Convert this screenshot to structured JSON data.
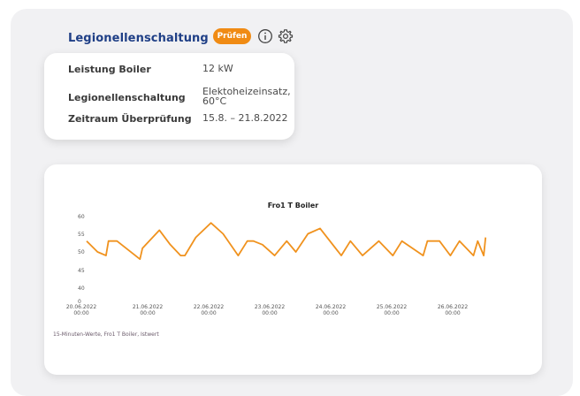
{
  "header": {
    "title": "Legionellenschaltung",
    "badge_label": "Prüfen",
    "info_icon": "info-icon",
    "settings_icon": "gear-icon"
  },
  "details": {
    "rows": [
      {
        "key": "Leistung Boiler",
        "value": "12 kW"
      },
      {
        "key": "Legionellenschaltung",
        "value": "Elektoheizeinsatz, 60°C"
      },
      {
        "key": "Zeitraum Überprüfung",
        "value": "15.8. – 21.8.2022"
      }
    ]
  },
  "colors": {
    "accent": "#f08b14",
    "title": "#1f3f86",
    "line": "#f0921e"
  },
  "chart_data": {
    "type": "line",
    "title": "Fro1 T Boiler",
    "footnote": "15-Minuten-Werte, Fro1 T Boiler, Istwert",
    "yticks": [
      "60",
      "55",
      "50",
      "45",
      "40",
      "0"
    ],
    "xticks": [
      {
        "date": "20.06.2022",
        "time": "00:00"
      },
      {
        "date": "21.06.2022",
        "time": "00:00"
      },
      {
        "date": "22.06.2022",
        "time": "00:00"
      },
      {
        "date": "23.06.2022",
        "time": "00:00"
      },
      {
        "date": "24.06.2022",
        "time": "00:00"
      },
      {
        "date": "25.06.2022",
        "time": "00:00"
      },
      {
        "date": "26.06.2022",
        "time": "00:00"
      }
    ],
    "series": [
      {
        "x_days": [
          0.0,
          0.18,
          0.32,
          0.36,
          0.5,
          0.88,
          0.92,
          1.2,
          1.38,
          1.55,
          1.62,
          1.8,
          2.05,
          2.25,
          2.5,
          2.65,
          2.75,
          2.9,
          3.1,
          3.3,
          3.45,
          3.65,
          3.85,
          4.2,
          4.35,
          4.55,
          4.82,
          5.05,
          5.2,
          5.55,
          5.62,
          5.82,
          6.0,
          6.15,
          6.38,
          6.45,
          6.55,
          6.58
        ],
        "values": [
          53,
          50,
          49,
          53,
          53,
          48,
          51,
          56,
          52,
          49,
          49,
          54,
          58,
          55,
          49,
          53,
          53,
          52,
          49,
          53,
          50,
          55,
          56.5,
          49,
          53,
          49,
          53,
          49,
          53,
          49,
          53,
          53,
          49,
          53,
          49,
          53,
          49,
          54
        ]
      }
    ],
    "xlim_days": [
      0,
      7
    ],
    "ylim": [
      40,
      60
    ]
  }
}
